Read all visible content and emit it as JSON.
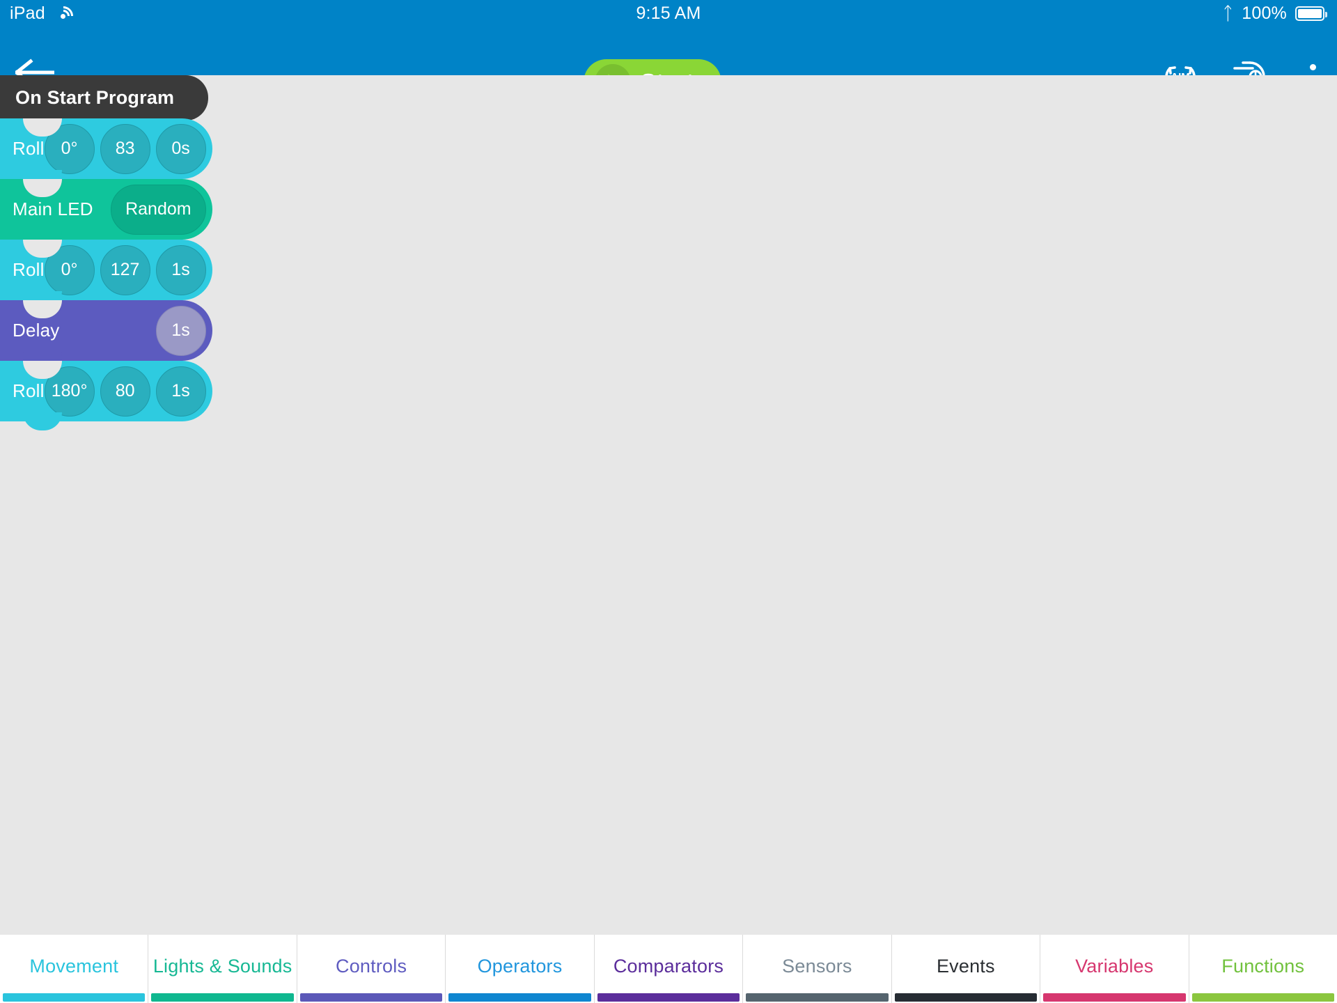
{
  "status_bar": {
    "device": "iPad",
    "wifi_icon": "wifi-icon",
    "time": "9:15 AM",
    "bluetooth_icon": "bluetooth-icon",
    "battery_percent": "100%",
    "battery_icon": "battery-full-icon"
  },
  "toolbar": {
    "back_icon": "back-arrow-icon",
    "start_label": "Start",
    "play_icon": "play-icon",
    "aim_icon": "aim-icon",
    "drive_icon": "drive-icon",
    "overflow_icon": "kebab-menu-icon",
    "bar_color": "#0083c7",
    "start_color": "#8ad636"
  },
  "program": {
    "header_label": "On Start Program",
    "blocks": [
      {
        "name": "Roll",
        "type": "movement",
        "color": "#2ecbe0",
        "params": [
          {
            "value": "0°",
            "kind": "heading"
          },
          {
            "value": "83",
            "kind": "speed"
          },
          {
            "value": "0s",
            "kind": "duration"
          }
        ]
      },
      {
        "name": "Main LED",
        "type": "lights",
        "color": "#0fc49b",
        "params": [
          {
            "value": "Random",
            "kind": "color",
            "pill": true
          }
        ]
      },
      {
        "name": "Roll",
        "type": "movement",
        "color": "#2ecbe0",
        "params": [
          {
            "value": "0°",
            "kind": "heading"
          },
          {
            "value": "127",
            "kind": "speed"
          },
          {
            "value": "1s",
            "kind": "duration"
          }
        ]
      },
      {
        "name": "Delay",
        "type": "controls",
        "color": "#5c5bbf",
        "params": [
          {
            "value": "1s",
            "kind": "duration"
          }
        ]
      },
      {
        "name": "Roll",
        "type": "movement",
        "color": "#2ecbe0",
        "params": [
          {
            "value": "180°",
            "kind": "heading"
          },
          {
            "value": "80",
            "kind": "speed"
          },
          {
            "value": "1s",
            "kind": "duration"
          }
        ]
      }
    ]
  },
  "tab_bar": {
    "tabs": [
      {
        "label": "Movement",
        "color": "#2ac4dd",
        "bar": "#2ac4dd"
      },
      {
        "label": "Lights & Sounds",
        "color": "#17b894",
        "bar": "#0fb78f"
      },
      {
        "label": "Controls",
        "color": "#5f5cc0",
        "bar": "#5b58b8"
      },
      {
        "label": "Operators",
        "color": "#2196dd",
        "bar": "#0f86d0"
      },
      {
        "label": "Comparators",
        "color": "#5b2d9b",
        "bar": "#5b2d9b"
      },
      {
        "label": "Sensors",
        "color": "#7b8a96",
        "bar": "#55646e"
      },
      {
        "label": "Events",
        "color": "#2b2f33",
        "bar": "#262c33"
      },
      {
        "label": "Variables",
        "color": "#d6376f",
        "bar": "#d6376f"
      },
      {
        "label": "Functions",
        "color": "#71c13d",
        "bar": "#8bc63f"
      }
    ]
  }
}
